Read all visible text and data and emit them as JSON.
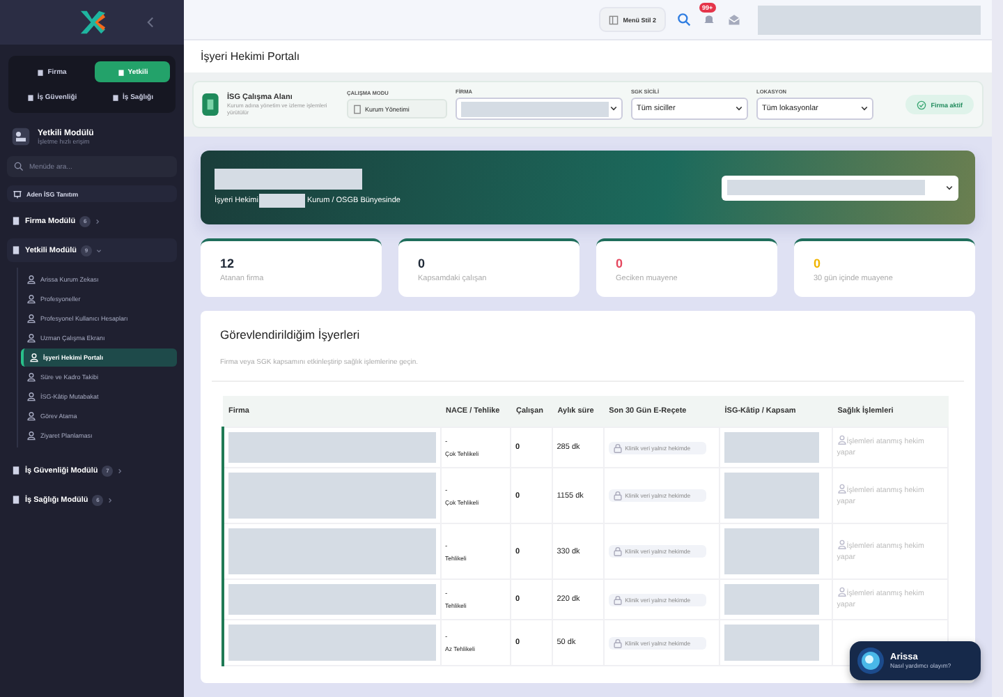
{
  "sidebar": {
    "role_tabs": [
      {
        "label": "Firma",
        "selected": false
      },
      {
        "label": "Yetkili",
        "selected": true
      },
      {
        "label": "İş Güvenliği",
        "selected": false
      },
      {
        "label": "İş Sağlığı",
        "selected": false
      }
    ],
    "header": {
      "title": "Yetkili Modülü",
      "subtitle": "İşletme hızlı erişim"
    },
    "search": {
      "placeholder": "Menüde ara..."
    },
    "intro": "Aden İSG Tanıtım",
    "modules": [
      {
        "label": "Firma Modülü",
        "badge": "6",
        "expanded": false
      },
      {
        "label": "Yetkili Modülü",
        "badge": "9",
        "expanded": true,
        "children": [
          {
            "label": "Arissa Kurum Zekası",
            "selected": false
          },
          {
            "label": "Profesyoneller",
            "selected": false
          },
          {
            "label": "Profesyonel Kullanıcı Hesapları",
            "selected": false
          },
          {
            "label": "Uzman Çalışma Ekranı",
            "selected": false
          },
          {
            "label": "İşyeri Hekimi Portalı",
            "selected": true
          },
          {
            "label": "Süre ve Kadro Takibi",
            "selected": false
          },
          {
            "label": "İSG-Kâtip Mutabakat",
            "selected": false
          },
          {
            "label": "Görev Atama",
            "selected": false
          },
          {
            "label": "Ziyaret Planlaması",
            "selected": false
          }
        ]
      },
      {
        "label": "İş Güvenliği Modülü",
        "badge": "7",
        "expanded": false
      },
      {
        "label": "İş Sağlığı Modülü",
        "badge": "6",
        "expanded": false
      }
    ]
  },
  "topbar": {
    "menu_style": "Menü Stil 2",
    "notification_badge": "99+"
  },
  "page_title": "İşyeri Hekimi Portalı",
  "workspace": {
    "title": "İSG Çalışma Alanı",
    "subtitle": "Kurum adına yönetim ve izleme işlemleri yürütülür",
    "fields": [
      {
        "label": "ÇALIŞMA MODU",
        "kind": "chip",
        "value": "Kurum Yönetimi"
      },
      {
        "label": "FİRMA",
        "kind": "redacted"
      },
      {
        "label": "SGK SİCİLİ",
        "kind": "select",
        "value": "Tüm siciller"
      },
      {
        "label": "LOKASYON",
        "kind": "select",
        "value": "Tüm lokasyonlar"
      }
    ],
    "status": "Firma aktif"
  },
  "hero": {
    "role": "İşyeri Hekimi",
    "scope": "Kurum / OSGB Bünyesinde"
  },
  "stats": [
    {
      "value": "12",
      "label": "Atanan firma",
      "color": "#1f2937"
    },
    {
      "value": "0",
      "label": "Kapsamdaki çalışan",
      "color": "#1f2937"
    },
    {
      "value": "0",
      "label": "Geciken muayene",
      "color": "#e5485f"
    },
    {
      "value": "0",
      "label": "30 gün içinde muayene",
      "color": "#f0b400"
    }
  ],
  "card": {
    "title": "Görevlendirildiğim İşyerleri",
    "subtitle": "Firma veya SGK kapsamını etkinleştirip sağlık işlemlerine geçin."
  },
  "table": {
    "columns": [
      "Firma",
      "NACE / Tehlike",
      "Çalışan",
      "Aylık süre",
      "Son 30 Gün E-Reçete",
      "İSG-Kâtip / Kapsam",
      "Sağlık İşlemleri"
    ],
    "rows": [
      {
        "nace": "-",
        "hazard": "Çok Tehlikeli",
        "employees": "0",
        "duration": "285 dk",
        "prescription": "Klinik veri yalnız hekimde",
        "action": "İşlemleri atanmış hekim yapar"
      },
      {
        "nace": "-",
        "hazard": "Çok Tehlikeli",
        "employees": "0",
        "duration": "1155 dk",
        "prescription": "Klinik veri yalnız hekimde",
        "action": "İşlemleri atanmış hekim yapar"
      },
      {
        "nace": "-",
        "hazard": "Tehlikeli",
        "employees": "0",
        "duration": "330 dk",
        "prescription": "Klinik veri yalnız hekimde",
        "action": "İşlemleri atanmış hekim yapar"
      },
      {
        "nace": "-",
        "hazard": "Tehlikeli",
        "employees": "0",
        "duration": "220 dk",
        "prescription": "Klinik veri yalnız hekimde",
        "action": "İşlemleri atanmış hekim yapar"
      },
      {
        "nace": "-",
        "hazard": "Az Tehlikeli",
        "employees": "0",
        "duration": "50 dk",
        "prescription": "Klinik veri yalnız hekimde"
      }
    ]
  },
  "assistant": {
    "name": "Arissa",
    "prompt": "Nasıl yardımcı olayım?"
  }
}
